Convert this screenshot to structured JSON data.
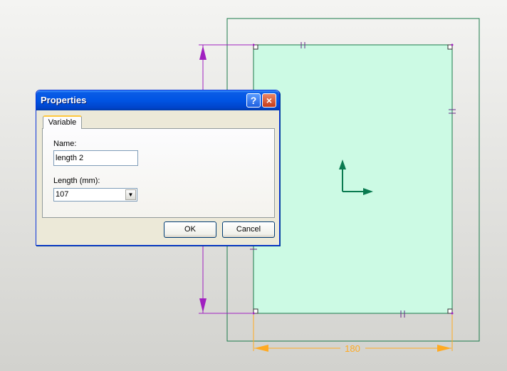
{
  "drawing": {
    "dimension_horizontal": "180",
    "colors": {
      "rectangle_fill": "#ccfae4",
      "rectangle_stroke": "#1a7a4a",
      "dimension_magenta": "#a020c0",
      "dimension_orange": "#ffaa22",
      "axis_green": "#0a7a50"
    }
  },
  "dialog": {
    "title": "Properties",
    "help_icon": "?",
    "close_icon": "×",
    "tab_label": "Variable",
    "name_label": "Name:",
    "name_value": "length 2",
    "length_label": "Length (mm):",
    "length_value": "107",
    "ok_label": "OK",
    "cancel_label": "Cancel"
  }
}
